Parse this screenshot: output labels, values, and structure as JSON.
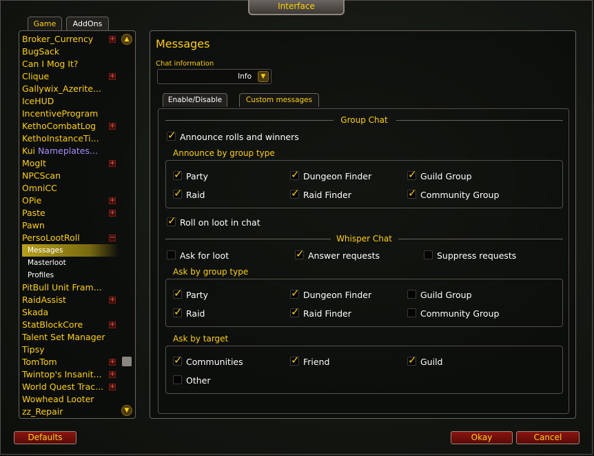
{
  "window": {
    "title": "Interface"
  },
  "tabs": {
    "game": "Game",
    "addons": "AddOns"
  },
  "addon_list": [
    {
      "label": "Broker_Currency",
      "plus": true
    },
    {
      "label": "BugSack"
    },
    {
      "label": "Can I Mog It?"
    },
    {
      "label": "Clique",
      "plus": true
    },
    {
      "label": "Gallywix_Azerite..."
    },
    {
      "label": "IceHUD"
    },
    {
      "label": "IncentiveProgram"
    },
    {
      "label": "KethoCombatLog",
      "plus": true
    },
    {
      "label": "KethoInstanceTi..."
    },
    {
      "label": "Kui ",
      "purple": "Nameplates..."
    },
    {
      "label": "MogIt",
      "plus": true
    },
    {
      "label": "NPCScan"
    },
    {
      "label": "OmniCC"
    },
    {
      "label": "OPie",
      "plus": true
    },
    {
      "label": "Paste",
      "plus": true
    },
    {
      "label": "Pawn"
    },
    {
      "label": "PersoLootRoll",
      "minus": true
    },
    {
      "label": "Messages",
      "sub": true,
      "selected": true
    },
    {
      "label": "Masterloot",
      "sub": true
    },
    {
      "label": "Profiles",
      "sub": true
    },
    {
      "label": "PitBull Unit Fram..."
    },
    {
      "label": "RaidAssist",
      "plus": true
    },
    {
      "label": "Skada"
    },
    {
      "label": "StatBlockCore",
      "plus": true
    },
    {
      "label": "Talent Set Manager"
    },
    {
      "label": "Tipsy"
    },
    {
      "label": "TomTom",
      "plus": true
    },
    {
      "label": "Twintop's Insanit...",
      "plus": true
    },
    {
      "label": "World Quest Trac...",
      "plus": true
    },
    {
      "label": "Wowhead Looter"
    },
    {
      "label": "zz_Repair"
    }
  ],
  "panel": {
    "title": "Messages",
    "chat_info_label": "Chat information",
    "chat_info_value": "Info",
    "subtabs": {
      "enable": "Enable/Disable",
      "custom": "Custom messages"
    },
    "group_chat": {
      "header": "Group Chat",
      "announce": {
        "label": "Announce rolls and winners",
        "checked": true
      },
      "by_type_label": "Announce by group type",
      "types": [
        {
          "label": "Party",
          "checked": true
        },
        {
          "label": "Dungeon Finder",
          "checked": true
        },
        {
          "label": "Guild Group",
          "checked": true
        },
        {
          "label": "Raid",
          "checked": true
        },
        {
          "label": "Raid Finder",
          "checked": true
        },
        {
          "label": "Community Group",
          "checked": true
        }
      ],
      "roll_on_loot": {
        "label": "Roll on loot in chat",
        "checked": true
      }
    },
    "whisper_chat": {
      "header": "Whisper Chat",
      "options": [
        {
          "label": "Ask for loot",
          "checked": false
        },
        {
          "label": "Answer requests",
          "checked": true
        },
        {
          "label": "Suppress requests",
          "checked": false
        }
      ],
      "ask_by_type_label": "Ask by group type",
      "ask_types": [
        {
          "label": "Party",
          "checked": true
        },
        {
          "label": "Dungeon Finder",
          "checked": true
        },
        {
          "label": "Guild Group",
          "checked": false
        },
        {
          "label": "Raid",
          "checked": true
        },
        {
          "label": "Raid Finder",
          "checked": true
        },
        {
          "label": "Community Group",
          "checked": false
        }
      ],
      "ask_by_target_label": "Ask by target",
      "targets": [
        {
          "label": "Communities",
          "checked": true
        },
        {
          "label": "Friend",
          "checked": true
        },
        {
          "label": "Guild",
          "checked": true
        },
        {
          "label": "Other",
          "checked": false
        }
      ]
    }
  },
  "buttons": {
    "defaults": "Defaults",
    "okay": "Okay",
    "cancel": "Cancel"
  }
}
